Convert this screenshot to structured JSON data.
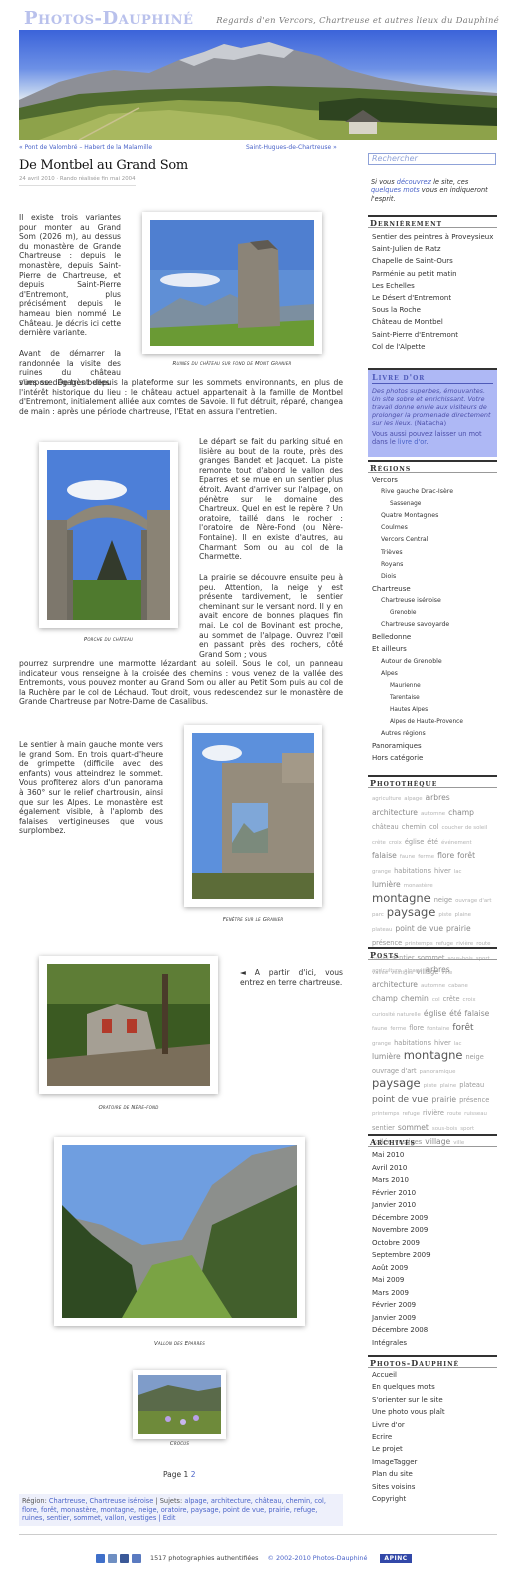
{
  "header": {
    "site_title": "Photos-Dauphiné",
    "tagline": "Regards d'en Vercors, Chartreuse et autres lieux du Dauphiné"
  },
  "nav": {
    "prev": "« Pont de Valombré – Habert de la Malamille",
    "next": "Saint-Hugues-de-Chartreuse »"
  },
  "post": {
    "title": "De Montbel au Grand Som",
    "meta": "24 avril 2010 · Rando réalisée fin mai 2004",
    "p1": "Il existe trois variantes pour monter au Grand Som (2026 m), au dessus du monastère de Grande Chartreuse : depuis le monastère, depuis Saint-Pierre de Chartreuse, et depuis Saint-Pierre d'Entremont, plus précisément depuis le hameau bien nommé Le Château. Je décris ici cette dernière variante.",
    "p2a": "Avant de démarrer la randonnée la visite des ruines du château s'impose. De très belles",
    "p2b": "vues se dégagent depuis la plateforme sur les sommets environnants, en plus de l'intérêt historique du lieu : le château actuel appartenait à la famille de Montbel d'Entremont, initialement alliée aux comtes de Savoie. Il fut détruit, réparé, changea de main : après une période chartreuse, l'Etat en assura l'entretien.",
    "p3": "Le départ se fait du parking situé en lisière au bout de la route, près des granges Bandet et Jacquet. La piste remonte tout d'abord le vallon des Eparres et se mue en un sentier plus étroit. Avant d'arriver sur l'alpage, on pénètre sur le domaine des Chartreux. Quel en est le repère ? Un oratoire, taillé dans le rocher : l'oratoire de Nère-Fond (ou Nère-Fontaine). Il en existe d'autres, au Charmant Som ou au col de la Charmette.",
    "p4a": "La prairie se découvre ensuite peu à peu. Attention, la neige y est présente tardivement, le sentier cheminant sur le versant nord. Il y en avait encore de bonnes plaques fin mai. Le col de Bovinant est proche, au sommet de l'alpage. Ouvrez l'œil en passant près des rochers, côté Grand Som ; vous",
    "p4b": "pourrez surprendre une marmotte lézardant au soleil. Sous le col, un panneau indicateur vous renseigne à la croisée des chemins : vous venez de la vallée des Entremonts, vous pouvez monter au Grand Som ou aller au Petit Som puis au col de la Ruchère par le col de Léchaud. Tout droit, vous redescendez sur le monastère de Grande Chartreuse par Notre-Dame de Casalibus.",
    "p5": "Le sentier à main gauche monte vers le grand Som. En trois quart-d'heure de grimpette (difficile avec des enfants) vous atteindrez le sommet. Vous profiterez alors d'un panorama à 360° sur le relief chartrousin, ainsi que sur les Alpes. Le monastère est également visible, à l'aplomb des falaises vertigineuses que vous surplombez.",
    "p6": "◄ A partir d'ici, vous entrez en terre chartreuse.",
    "captions": {
      "c1": "Ruines du château sur fond de Mont Granier",
      "c2": "Porche du château",
      "c3": "Fenêtre sur le Granier",
      "c4": "Oratoire de Nère-fond",
      "c5": "Vallon des Eparres",
      "c6": "Crocus"
    },
    "pager_label": "Page 1",
    "pager_link": "2",
    "region_label": "Région:",
    "regions": "Chartreuse, Chartreuse iséroise",
    "subjects_label": "| Sujets:",
    "subjects": "alpage, architecture, château, chemin, col, flore, forêt, monastère, montagne, neige, oratoire, paysage, point de vue, prairie, refuge, ruines, sentier, sommet, vallon, vestiges",
    "edit": "| Edit"
  },
  "footer": {
    "count": "1517 photographies authentifiées",
    "copyright": "© 2002-2010 Photos-Dauphiné",
    "badge": "APINC"
  },
  "sidebar": {
    "search_placeholder": "Rechercher",
    "intro_a": "Si vous ",
    "intro_link1": "découvrez",
    "intro_b": " le site, ces ",
    "intro_link2": "quelques mots",
    "intro_c": " vous en indiqueront l'esprit.",
    "dernierement_title": "Dernièrement",
    "dernierement": [
      "Sentier des peintres à Proveysieux",
      "Saint-Julien de Ratz",
      "Chapelle de Saint-Ours",
      "Parménie au petit matin",
      "Les Echelles",
      "Le Désert d'Entremont",
      "Sous la Roche",
      "Château de Montbel",
      "Saint-Pierre d'Entremont",
      "Col de l'Alpette"
    ],
    "livre_title": "Livre d'or",
    "livre_quote": "Des photos superbes, émouvantes. Un site sobre et enrichissant. Votre travail donne envie aux visiteurs de prolonger la promenade directement sur les lieux.",
    "livre_author": " (Natacha)",
    "livre_text2a": "Vous aussi pouvez laisser un mot dans le ",
    "livre_link": "livre d'or",
    "livre_text2b": ".",
    "regions_title": "Régions",
    "regions": [
      {
        "label": "Vercors",
        "level": 0
      },
      {
        "label": "Rive gauche Drac-Isère",
        "level": 1
      },
      {
        "label": "Sassenage",
        "level": 2
      },
      {
        "label": "Quatre Montagnes",
        "level": 1
      },
      {
        "label": "Coulmes",
        "level": 1
      },
      {
        "label": "Vercors Central",
        "level": 1
      },
      {
        "label": "Trièves",
        "level": 1
      },
      {
        "label": "Royans",
        "level": 1
      },
      {
        "label": "Diois",
        "level": 1
      },
      {
        "label": "Chartreuse",
        "level": 0
      },
      {
        "label": "Chartreuse iséroise",
        "level": 1
      },
      {
        "label": "Grenoble",
        "level": 2
      },
      {
        "label": "Chartreuse savoyarde",
        "level": 1
      },
      {
        "label": "Belledonne",
        "level": 0
      },
      {
        "label": "Et ailleurs",
        "level": 0
      },
      {
        "label": "Autour de Grenoble",
        "level": 1
      },
      {
        "label": "Alpes",
        "level": 1
      },
      {
        "label": "Maurienne",
        "level": 2
      },
      {
        "label": "Tarentaise",
        "level": 2
      },
      {
        "label": "Hautes Alpes",
        "level": 2
      },
      {
        "label": "Alpes de Haute-Provence",
        "level": 2
      },
      {
        "label": "Autres régions",
        "level": 1
      },
      {
        "label": "Panoramiques",
        "level": 0
      },
      {
        "label": "Hors catégorie",
        "level": 0
      }
    ],
    "phototheque_title": "Photothèque",
    "phototheque_tags": [
      [
        "agriculture",
        1
      ],
      [
        "alpage",
        1
      ],
      [
        "arbres",
        3
      ],
      [
        "architecture",
        3
      ],
      [
        "automne",
        1
      ],
      [
        "champ",
        3
      ],
      [
        "château",
        2
      ],
      [
        "chemin",
        2
      ],
      [
        "col",
        2
      ],
      [
        "coucher de soleil",
        1
      ],
      [
        "crête",
        1
      ],
      [
        "croix",
        1
      ],
      [
        "église",
        2
      ],
      [
        "été",
        2
      ],
      [
        "événement",
        1
      ],
      [
        "falaise",
        3
      ],
      [
        "faune",
        1
      ],
      [
        "ferme",
        1
      ],
      [
        "flore",
        3
      ],
      [
        "forêt",
        3
      ],
      [
        "grange",
        1
      ],
      [
        "habitations",
        2
      ],
      [
        "hiver",
        2
      ],
      [
        "lac",
        1
      ],
      [
        "lumière",
        3
      ],
      [
        "monastère",
        1
      ],
      [
        "montagne",
        5
      ],
      [
        "neige",
        2
      ],
      [
        "ouvrage d'art",
        1
      ],
      [
        "parc",
        1
      ],
      [
        "paysage",
        5
      ],
      [
        "piste",
        1
      ],
      [
        "plaine",
        1
      ],
      [
        "plateau",
        1
      ],
      [
        "point de vue",
        3
      ],
      [
        "prairie",
        3
      ],
      [
        "présence",
        2
      ],
      [
        "printemps",
        1
      ],
      [
        "refuge",
        1
      ],
      [
        "rivière",
        1
      ],
      [
        "route",
        1
      ],
      [
        "ruines",
        1
      ],
      [
        "sentier",
        2
      ],
      [
        "sommet",
        2
      ],
      [
        "sous-bois",
        1
      ],
      [
        "sport",
        1
      ],
      [
        "vallée",
        1
      ],
      [
        "vestiges",
        1
      ],
      [
        "village",
        2
      ],
      [
        "ville",
        1
      ]
    ],
    "posts_title": "Posts",
    "posts_tags": [
      [
        "agriculture",
        1
      ],
      [
        "alpage",
        1
      ],
      [
        "arbres",
        3
      ],
      [
        "architecture",
        3
      ],
      [
        "automne",
        1
      ],
      [
        "cabane",
        1
      ],
      [
        "champ",
        3
      ],
      [
        "chemin",
        3
      ],
      [
        "col",
        1
      ],
      [
        "crête",
        2
      ],
      [
        "croix",
        1
      ],
      [
        "curiosité naturelle",
        1
      ],
      [
        "église",
        3
      ],
      [
        "été",
        3
      ],
      [
        "falaise",
        3
      ],
      [
        "faune",
        1
      ],
      [
        "ferme",
        1
      ],
      [
        "flore",
        2
      ],
      [
        "fontaine",
        1
      ],
      [
        "forêt",
        4
      ],
      [
        "grange",
        1
      ],
      [
        "habitations",
        2
      ],
      [
        "hiver",
        2
      ],
      [
        "lac",
        1
      ],
      [
        "lumière",
        3
      ],
      [
        "montagne",
        5
      ],
      [
        "neige",
        2
      ],
      [
        "ouvrage d'art",
        2
      ],
      [
        "panoramique",
        1
      ],
      [
        "paysage",
        5
      ],
      [
        "piste",
        1
      ],
      [
        "plaine",
        1
      ],
      [
        "plateau",
        2
      ],
      [
        "point de vue",
        4
      ],
      [
        "prairie",
        3
      ],
      [
        "présence",
        2
      ],
      [
        "printemps",
        1
      ],
      [
        "refuge",
        1
      ],
      [
        "rivière",
        2
      ],
      [
        "route",
        1
      ],
      [
        "ruisseau",
        1
      ],
      [
        "sentier",
        2
      ],
      [
        "sommet",
        3
      ],
      [
        "sous-bois",
        1
      ],
      [
        "sport",
        1
      ],
      [
        "vallée",
        2
      ],
      [
        "vestiges",
        2
      ],
      [
        "village",
        3
      ],
      [
        "ville",
        1
      ]
    ],
    "archives_title": "Archives",
    "archives": [
      "Mai 2010",
      "Avril 2010",
      "Mars 2010",
      "Février 2010",
      "Janvier 2010",
      "Décembre 2009",
      "Novembre 2009",
      "Octobre 2009",
      "Septembre 2009",
      "Août 2009",
      "Mai 2009",
      "Mars 2009",
      "Février 2009",
      "Janvier 2009",
      "Décembre 2008",
      "Intégrales"
    ],
    "pd_title": "Photos-Dauphiné",
    "pd_links": [
      "Accueil",
      "En quelques mots",
      "S'orienter sur le site",
      "Une photo vous plaît",
      "Livre d'or",
      "Ecrire",
      "Le projet",
      "ImageTagger",
      "Plan du site",
      "Sites voisins",
      "Copyright"
    ]
  }
}
